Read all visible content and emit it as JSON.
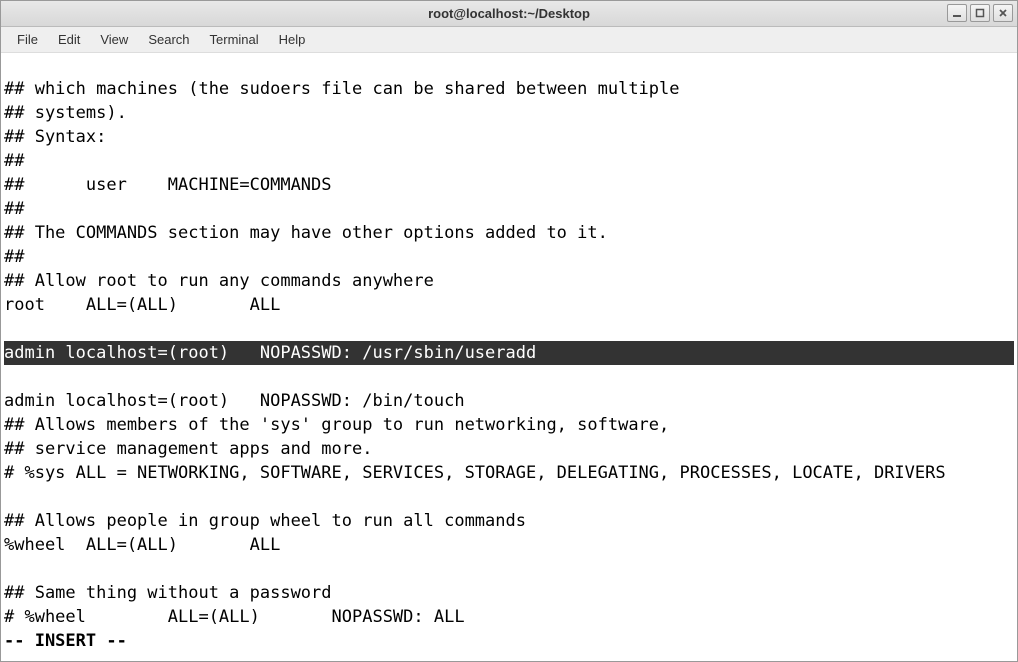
{
  "window": {
    "title": "root@localhost:~/Desktop"
  },
  "menubar": {
    "items": [
      {
        "label": "File"
      },
      {
        "label": "Edit"
      },
      {
        "label": "View"
      },
      {
        "label": "Search"
      },
      {
        "label": "Terminal"
      },
      {
        "label": "Help"
      }
    ]
  },
  "terminal": {
    "lines": [
      "## which machines (the sudoers file can be shared between multiple",
      "## systems).",
      "## Syntax:",
      "##",
      "##      user    MACHINE=COMMANDS",
      "##",
      "## The COMMANDS section may have other options added to it.",
      "##",
      "## Allow root to run any commands anywhere",
      "root    ALL=(ALL)       ALL",
      "",
      "admin localhost=(root)   NOPASSWD: /usr/sbin/useradd",
      "admin localhost=(root)   NOPASSWD: /bin/touch",
      "## Allows members of the 'sys' group to run networking, software,",
      "## service management apps and more.",
      "# %sys ALL = NETWORKING, SOFTWARE, SERVICES, STORAGE, DELEGATING, PROCESSES, LOCATE, DRIVERS",
      "",
      "## Allows people in group wheel to run all commands",
      "%wheel  ALL=(ALL)       ALL",
      "",
      "## Same thing without a password",
      "# %wheel        ALL=(ALL)       NOPASSWD: ALL"
    ],
    "highlighted_line_index": 11,
    "status_line": "-- INSERT --"
  }
}
